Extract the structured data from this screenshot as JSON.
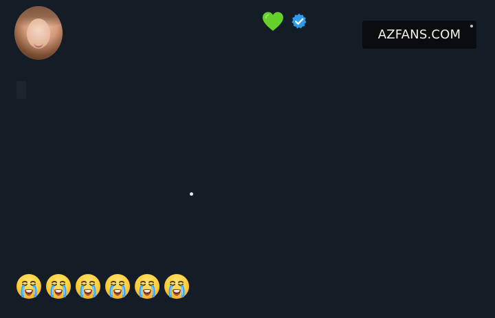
{
  "watermark": {
    "text": "AZFANS.COM"
  },
  "icons": {
    "heart": "green-heart-icon",
    "verified": "verified-check-icon"
  },
  "emoji_row": [
    {
      "icon": "loudly-crying-face-icon"
    },
    {
      "icon": "loudly-crying-face-icon"
    },
    {
      "icon": "loudly-crying-face-icon"
    },
    {
      "icon": "loudly-crying-face-icon"
    },
    {
      "icon": "loudly-crying-face-icon"
    },
    {
      "icon": "loudly-crying-face-icon"
    }
  ],
  "colors": {
    "background": "#141c26",
    "watermark_bg": "#0b0c10",
    "watermark_text": "#f2f2f2",
    "heart": "#66d02b",
    "verified": "#2d9cf0"
  }
}
